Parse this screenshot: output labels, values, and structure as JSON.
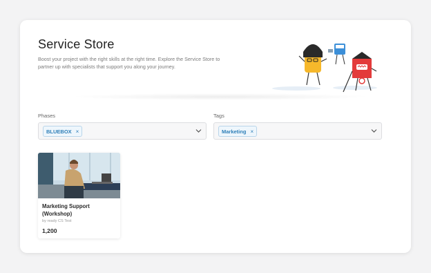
{
  "page": {
    "title": "Service Store",
    "description": "Boost your project with the right skills at the right time. Explore the Service Store to partner up with specialists that support you along your journey."
  },
  "filters": {
    "phases": {
      "label": "Phases",
      "chips": [
        "BLUEBOX"
      ],
      "chip_remove": "×"
    },
    "tags": {
      "label": "Tags",
      "chips": [
        "Marketing"
      ],
      "chip_remove": "×"
    }
  },
  "cards": [
    {
      "title": "Marketing Support (Workshop)",
      "provider": "by ready CS Test",
      "price": "1,200"
    }
  ],
  "icons": {
    "dropdown": "chevron-down-icon",
    "chip_remove": "close-icon"
  },
  "colors": {
    "chip_text": "#2f7fb8",
    "chip_border": "#b9d5ea",
    "panel_bg": "#ffffff",
    "page_bg": "#f3f3f4"
  }
}
